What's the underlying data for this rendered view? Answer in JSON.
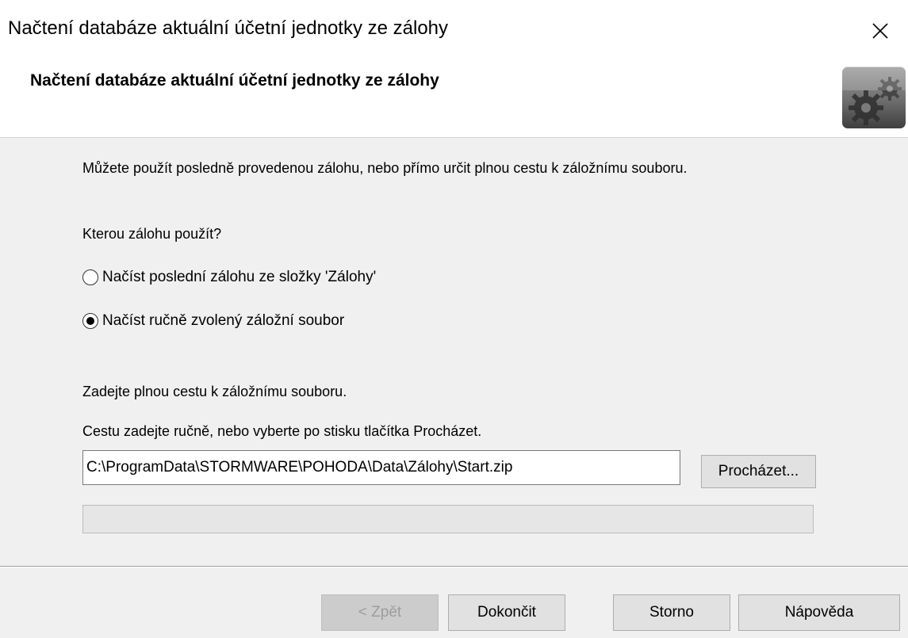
{
  "window": {
    "title": "Načtení databáze aktuální účetní jednotky ze zálohy"
  },
  "header": {
    "title": "Načtení databáze aktuální účetní jednotky ze zálohy",
    "icon": "gears-icon"
  },
  "content": {
    "intro": "Můžete použít posledně provedenou zálohu, nebo přímo určit plnou cestu k záložnímu souboru.",
    "question": "Kterou zálohu použít?",
    "options": [
      {
        "label": "Načíst poslední zálohu ze složky 'Zálohy'",
        "selected": false
      },
      {
        "label": "Načíst ručně zvolený záložní soubor",
        "selected": true
      }
    ],
    "path_caption": "Zadejte plnou cestu k záložnímu souboru.",
    "path_hint": "Cestu zadejte ručně, nebo vyberte po stisku tlačítka Procházet.",
    "path_value": "C:\\ProgramData\\STORMWARE\\POHODA\\Data\\Zálohy\\Start.zip",
    "browse_label": "Procházet...",
    "progress": 0
  },
  "footer": {
    "back_label": "< Zpět",
    "finish_label": "Dokončit",
    "cancel_label": "Storno",
    "help_label": "Nápověda"
  }
}
